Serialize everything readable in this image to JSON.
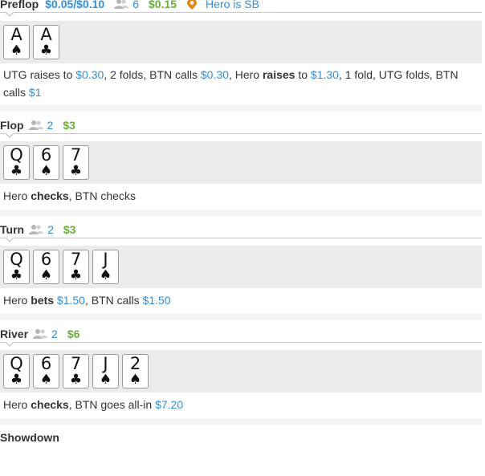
{
  "preflop": {
    "street": "Preflop",
    "blinds": "$0.05/$0.10",
    "players": "6",
    "pot": "$0.15",
    "hero_pos": "Hero is SB",
    "cards": [
      {
        "rank": "A",
        "suit": "♠"
      },
      {
        "rank": "A",
        "suit": "♣"
      }
    ],
    "action": {
      "p1": "UTG raises to ",
      "a1": "$0.30",
      "p2": ", 2 folds, BTN calls ",
      "a2": "$0.30",
      "p3": ", Hero ",
      "verb": "raises",
      "p4": " to ",
      "a3": "$1.30",
      "p5": ", 1 fold, UTG folds, BTN calls ",
      "a4": "$1"
    }
  },
  "flop": {
    "street": "Flop",
    "players": "2",
    "pot": "$3",
    "cards": [
      {
        "rank": "Q",
        "suit": "♣"
      },
      {
        "rank": "6",
        "suit": "♠"
      },
      {
        "rank": "7",
        "suit": "♣"
      }
    ],
    "action": {
      "p1": "Hero ",
      "verb": "checks",
      "p2": ", BTN checks"
    }
  },
  "turn": {
    "street": "Turn",
    "players": "2",
    "pot": "$3",
    "cards": [
      {
        "rank": "Q",
        "suit": "♣"
      },
      {
        "rank": "6",
        "suit": "♠"
      },
      {
        "rank": "7",
        "suit": "♣"
      },
      {
        "rank": "J",
        "suit": "♠"
      }
    ],
    "action": {
      "p1": "Hero ",
      "verb": "bets",
      "p2": " ",
      "a1": "$1.50",
      "p3": ", BTN calls ",
      "a2": "$1.50"
    }
  },
  "river": {
    "street": "River",
    "players": "2",
    "pot": "$6",
    "cards": [
      {
        "rank": "Q",
        "suit": "♣"
      },
      {
        "rank": "6",
        "suit": "♠"
      },
      {
        "rank": "7",
        "suit": "♣"
      },
      {
        "rank": "J",
        "suit": "♠"
      },
      {
        "rank": "2",
        "suit": "♠"
      }
    ],
    "action": {
      "p1": "Hero ",
      "verb": "checks",
      "p2": ", BTN goes all-in ",
      "a1": "$7.20"
    }
  },
  "showdown": {
    "street": "Showdown"
  },
  "icons": {
    "players": "players-icon",
    "position": "position-pin-icon"
  },
  "colors": {
    "amount": "#2f8fd8",
    "pot": "#6bab3c",
    "board_bg": "#ebebeb"
  }
}
